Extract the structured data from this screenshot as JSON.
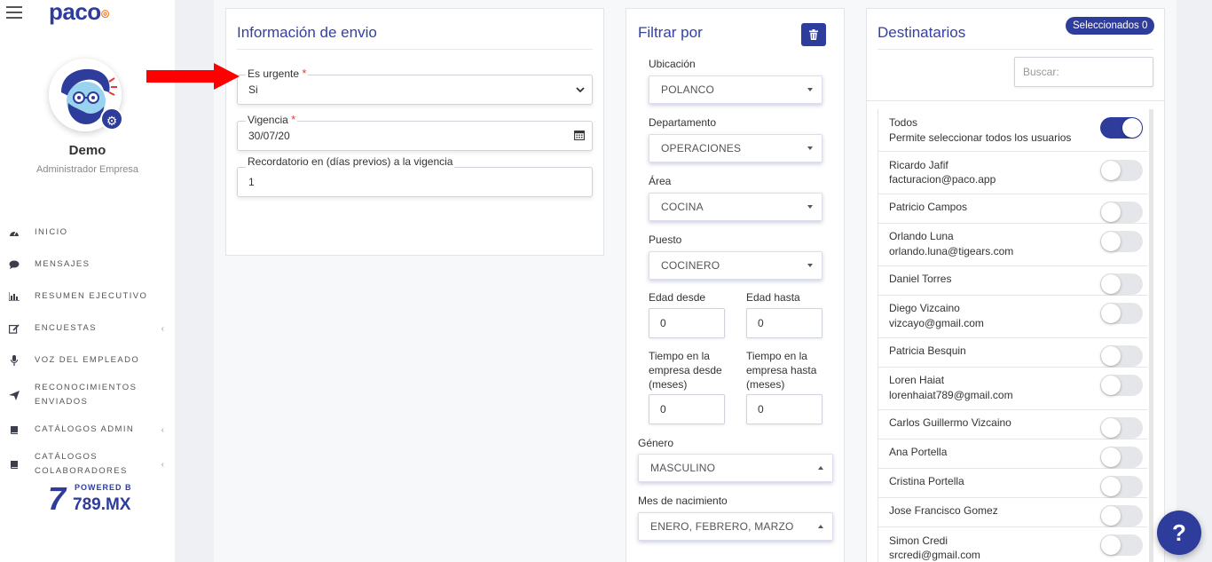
{
  "app": {
    "logo": "paco"
  },
  "user": {
    "name": "Demo",
    "role": "Administrador Empresa"
  },
  "sidebar": {
    "items": [
      {
        "label": "INICIO",
        "icon": "dashboard-icon"
      },
      {
        "label": "MENSAJES",
        "icon": "chat-icon"
      },
      {
        "label": "RESUMEN EJECUTIVO",
        "icon": "bar-chart-icon"
      },
      {
        "label": "ENCUESTAS",
        "icon": "edit-icon"
      },
      {
        "label": "VOZ DEL EMPLEADO",
        "icon": "microphone-icon"
      },
      {
        "label": "RECONOCIMIENTOS ENVIADOS",
        "line1": "RECONOCIMIENTOS",
        "line2": "ENVIADOS",
        "icon": "send-icon"
      },
      {
        "label": "CATÁLOGOS ADMIN",
        "icon": "book-icon"
      },
      {
        "label": "CATÁLOGOS COLABORADORES",
        "line1": "CATÁLOGOS",
        "line2": "COLABORADORES",
        "icon": "book-icon"
      }
    ],
    "powered_by": "POWERED BY",
    "powered_brand": "789.MX"
  },
  "envio": {
    "title": "Información de envio",
    "urgente_label": "Es urgente",
    "urgente_value": "Si",
    "vigencia_label": "Vigencia",
    "vigencia_value": "30/07/20",
    "recordatorio_label": "Recordatorio en (días previos) a la vigencia",
    "recordatorio_value": "1",
    "required_mark": "*"
  },
  "filtro": {
    "title": "Filtrar por",
    "ubicacion_label": "Ubicación",
    "ubicacion_value": "POLANCO",
    "departamento_label": "Departamento",
    "departamento_value": "OPERACIONES",
    "area_label": "Área",
    "area_value": "COCINA",
    "puesto_label": "Puesto",
    "puesto_value": "COCINERO",
    "edad_desde_label": "Edad desde",
    "edad_desde_value": "0",
    "edad_hasta_label": "Edad hasta",
    "edad_hasta_value": "0",
    "tiempo_desde_label": [
      "Tiempo en la",
      "empresa desde",
      "(meses)"
    ],
    "tiempo_desde_value": "0",
    "tiempo_hasta_label": [
      "Tiempo en la",
      "empresa hasta",
      "(meses)"
    ],
    "tiempo_hasta_value": "0",
    "genero_label": "Género",
    "genero_value": "MASCULINO",
    "mes_label": "Mes de nacimiento",
    "mes_value": "ENERO, FEBRERO, MARZO"
  },
  "destinatarios": {
    "title": "Destinatarios",
    "badge": "Seleccionados 0",
    "search_placeholder": "Buscar:",
    "items": [
      {
        "name": "Todos",
        "sub": "Permite seleccionar todos los usuarios",
        "on": true
      },
      {
        "name": "Ricardo Jafif",
        "sub": "facturacion@paco.app",
        "on": false
      },
      {
        "name": "Patricio Campos",
        "sub": "",
        "on": false
      },
      {
        "name": "Orlando Luna",
        "sub": "orlando.luna@tigears.com",
        "on": false
      },
      {
        "name": "Daniel Torres",
        "sub": "",
        "on": false
      },
      {
        "name": "Diego Vizcaino",
        "sub": "vizcayo@gmail.com",
        "on": false
      },
      {
        "name": "Patricia Besquin",
        "sub": "",
        "on": false
      },
      {
        "name": "Loren Haiat",
        "sub": "lorenhaiat789@gmail.com",
        "on": false
      },
      {
        "name": "Carlos Guillermo Vizcaino",
        "sub": "",
        "on": false
      },
      {
        "name": "Ana Portella",
        "sub": "",
        "on": false
      },
      {
        "name": "Cristina Portella",
        "sub": "",
        "on": false
      },
      {
        "name": "Jose Francisco Gomez",
        "sub": "",
        "on": false
      },
      {
        "name": "Simon Credi",
        "sub": "srcredi@gmail.com",
        "on": false
      }
    ]
  },
  "help": {
    "label": "?"
  }
}
